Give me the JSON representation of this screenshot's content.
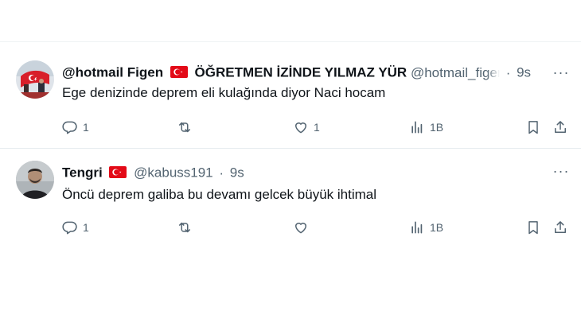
{
  "tweets": [
    {
      "name": "@hotmail Figen",
      "display_suffix": "ÖĞRETMEN İZİNDE YILMAZ YÜR",
      "handle": "@hotmail_figen",
      "dot": "·",
      "time": "9s",
      "text": "Ege denizinde deprem eli kulağında diyor Naci hocam",
      "replies": "1",
      "retweets": "",
      "likes": "1",
      "views": "1B",
      "more": "···"
    },
    {
      "name": "Tengri",
      "display_suffix": "",
      "handle": "@kabuss191",
      "dot": "·",
      "time": "9s",
      "text": "Öncü deprem galiba bu devamı gelcek büyük ihtimal",
      "replies": "1",
      "retweets": "",
      "likes": "",
      "views": "1B",
      "more": "···"
    }
  ],
  "colors": {
    "text_primary": "#0f1419",
    "text_secondary": "#536471",
    "divider": "#eff3f4",
    "flag_red": "#e30a17"
  },
  "icons": [
    "turkey-flag-icon",
    "reply-icon",
    "retweet-icon",
    "like-icon",
    "views-icon",
    "bookmark-icon",
    "share-icon",
    "more-icon"
  ]
}
